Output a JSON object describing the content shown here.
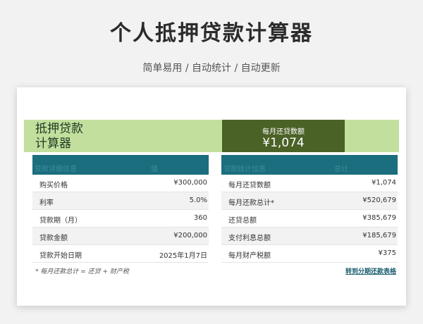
{
  "header": {
    "title": "个人抵押贷款计算器",
    "subtitle": "简单易用  /  自动统计  /  自动更新"
  },
  "banner": {
    "title_line1": "抵押贷款",
    "title_line2": "计算器",
    "monthly_payment_label": "每月还贷数额",
    "monthly_payment_value": "¥1,074"
  },
  "left_table": {
    "header_col1": "贷款详细信息",
    "header_col2": "值",
    "rows": [
      {
        "label": "购买价格",
        "value": "¥300,000"
      },
      {
        "label": "利率",
        "value": "5.0%"
      },
      {
        "label": "贷款期（月）",
        "value": "360"
      },
      {
        "label": "贷款金额",
        "value": "¥200,000"
      },
      {
        "label": "贷款开始日期",
        "value": "2025年1月7日"
      }
    ]
  },
  "right_table": {
    "header_col1": "贷款统计信息",
    "header_col2": "总计",
    "rows": [
      {
        "label": "每月还贷数额",
        "value": "¥1,074"
      },
      {
        "label": "每月还款总计*",
        "value": "¥520,679"
      },
      {
        "label": "还贷总额",
        "value": "¥385,679"
      },
      {
        "label": "支付利息总额",
        "value": "¥185,679"
      },
      {
        "label": "每月财产税额",
        "value": "¥375"
      }
    ]
  },
  "footer": {
    "note": "* 每月还款总计 = 还贷 + 财产税",
    "link": "转到分期还款表格"
  },
  "colors": {
    "banner_bg": "#c3df9e",
    "payment_box_bg": "#4b6227",
    "table_header_bg": "#1b6e7e"
  }
}
